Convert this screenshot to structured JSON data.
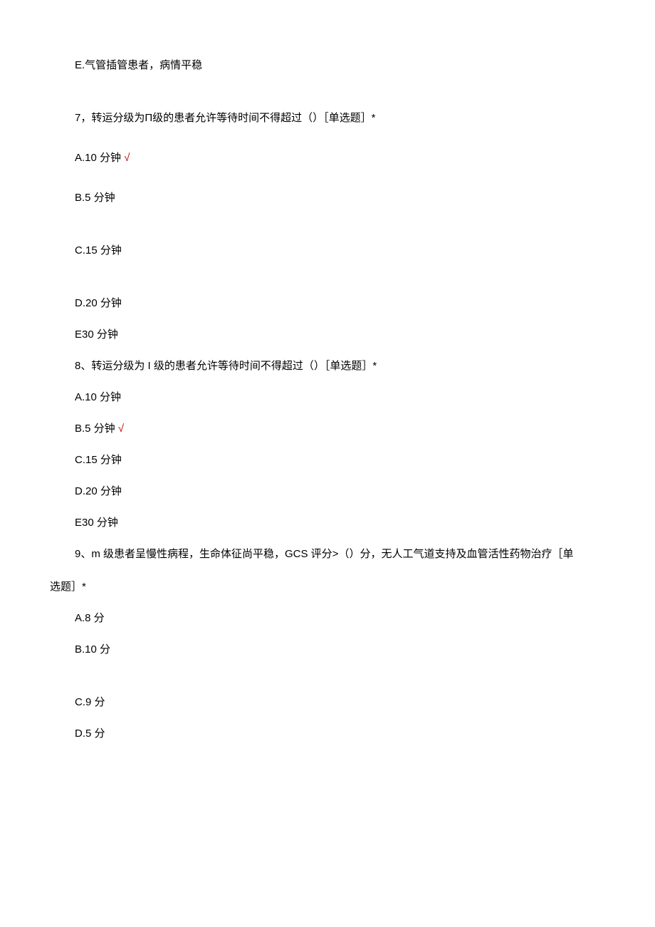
{
  "marks": {
    "check": "√"
  },
  "lines": {
    "optE_q6": "E.气管插管患者，病情平稳",
    "q7": "7，转运分级为Π级的患者允许等待时间不得超过（）［单选题］*",
    "q7_a": "A.10 分钟 ",
    "q7_b": "B.5 分钟",
    "q7_c": "C.15 分钟",
    "q7_d": "D.20 分钟",
    "q7_e": "E30 分钟",
    "q8": "8、转运分级为 I 级的患者允许等待时间不得超过（）［单选题］*",
    "q8_a": "A.10 分钟",
    "q8_b": "B.5 分钟 ",
    "q8_c": "C.15 分钟",
    "q8_d": "D.20 分钟",
    "q8_e": "E30 分钟",
    "q9_part1": "9、m 级患者呈慢性病程，生命体征尚平稳，GCS 评分>（）分，无人工气道支持及血管活性药物治疗［单",
    "q9_part2": "选题］*",
    "q9_a": "A.8 分",
    "q9_b": "B.10 分",
    "q9_c": "C.9 分",
    "q9_d": "D.5 分"
  }
}
